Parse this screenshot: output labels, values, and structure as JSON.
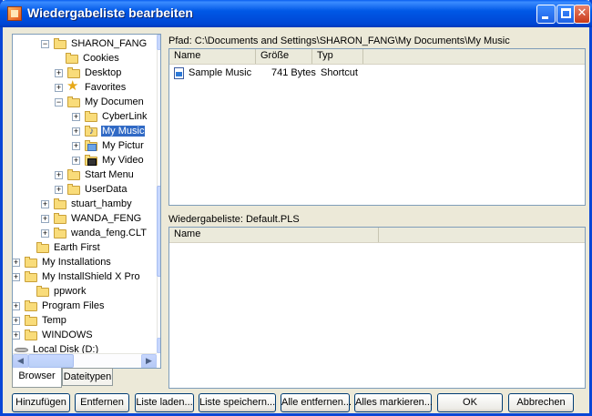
{
  "window": {
    "title": "Wiedergabeliste bearbeiten",
    "title_buttons": [
      "minimize",
      "maximize",
      "close"
    ]
  },
  "tree": {
    "items": [
      {
        "label": "SHARON_FANG",
        "icon": "folder",
        "expander": "−"
      },
      {
        "label": "Cookies",
        "icon": "folder",
        "expander": ""
      },
      {
        "label": "Desktop",
        "icon": "folder",
        "expander": "+"
      },
      {
        "label": "Favorites",
        "icon": "star",
        "expander": "+"
      },
      {
        "label": "My Documen",
        "icon": "folder",
        "expander": "−"
      },
      {
        "label": "CyberLink",
        "icon": "folder",
        "expander": "+"
      },
      {
        "label": "My Music",
        "icon": "music-folder",
        "expander": "+",
        "selected": true
      },
      {
        "label": "My Pictur",
        "icon": "pictures-folder",
        "expander": "+"
      },
      {
        "label": "My Video",
        "icon": "video-folder",
        "expander": "+"
      },
      {
        "label": "Start Menu",
        "icon": "folder",
        "expander": "+"
      },
      {
        "label": "UserData",
        "icon": "folder",
        "expander": "+"
      },
      {
        "label": "stuart_hamby",
        "icon": "folder",
        "expander": "+"
      },
      {
        "label": "WANDA_FENG",
        "icon": "folder",
        "expander": "+"
      },
      {
        "label": "wanda_feng.CLT",
        "icon": "folder",
        "expander": "+"
      },
      {
        "label": "Earth First",
        "icon": "folder",
        "expander": ""
      },
      {
        "label": "My Installations",
        "icon": "folder",
        "expander": "+"
      },
      {
        "label": "My InstallShield X Pro",
        "icon": "folder",
        "expander": "+"
      },
      {
        "label": "ppwork",
        "icon": "folder",
        "expander": ""
      },
      {
        "label": "Program Files",
        "icon": "folder",
        "expander": "+"
      },
      {
        "label": "Temp",
        "icon": "folder",
        "expander": "+"
      },
      {
        "label": "WINDOWS",
        "icon": "folder",
        "expander": "+"
      },
      {
        "label": "Local Disk (D:)",
        "icon": "disk",
        "expander": ""
      }
    ]
  },
  "tabs": [
    {
      "label": "Browser",
      "active": true
    },
    {
      "label": "Dateitypen",
      "active": false
    }
  ],
  "file_panel": {
    "path_label": "Pfad: C:\\Documents and Settings\\SHARON_FANG\\My Documents\\My Music",
    "columns": [
      "Name",
      "Größe",
      "Typ"
    ],
    "rows": [
      {
        "name": "Sample Music",
        "size": "741 Bytes",
        "type": "Shortcut"
      }
    ]
  },
  "playlist_panel": {
    "label": "Wiedergabeliste: Default.PLS",
    "columns": [
      "Name"
    ]
  },
  "buttons": {
    "add": "Hinzufügen",
    "remove": "Entfernen",
    "load": "Liste laden...",
    "save": "Liste speichern...",
    "remove_all": "Alle entfernen...",
    "select_all": "Alles markieren...",
    "ok": "OK",
    "cancel": "Abbrechen"
  }
}
